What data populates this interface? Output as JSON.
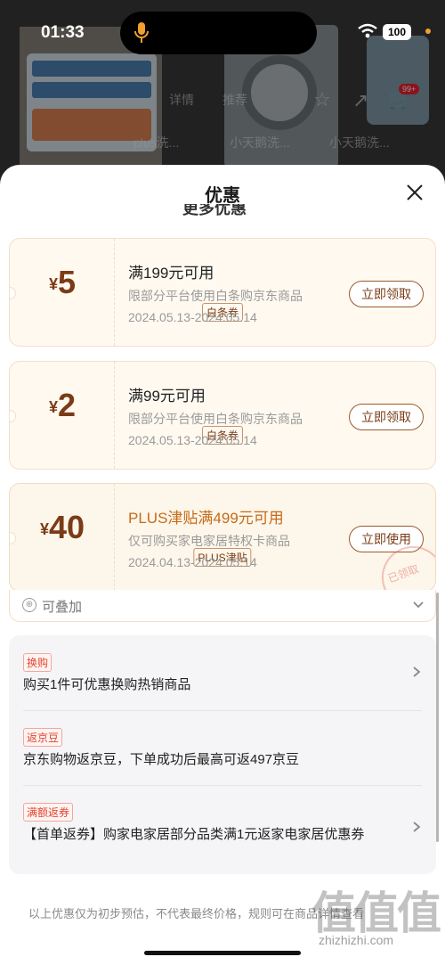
{
  "status_bar": {
    "time": "01:33",
    "battery": "100"
  },
  "background": {
    "detail_label": "详情",
    "recommend_label": "推荐",
    "cart_badge": "99+",
    "thumb_labels": [
      "plus洗...",
      "小天鹅洗...",
      "小天鹅洗..."
    ]
  },
  "sheet": {
    "title": "优惠",
    "peek_heading": "更多优惠",
    "coupons": [
      {
        "currency": "¥",
        "amount": "5",
        "type_tag": "白条券",
        "title": "满199元可用",
        "desc": "限部分平台使用白条购京东商品",
        "date_range": "2024.05.13-2024.05.14",
        "button": "立即领取"
      },
      {
        "currency": "¥",
        "amount": "2",
        "type_tag": "白条券",
        "title": "满99元可用",
        "desc": "限部分平台使用白条购京东商品",
        "date_range": "2024.05.13-2024.05.14",
        "button": "立即领取"
      },
      {
        "currency": "¥",
        "amount": "40",
        "type_tag": "PLUS津贴",
        "title": "PLUS津贴满499元可用",
        "desc": "仅可购买家电家居特权卡商品",
        "date_range": "2024.04.13-2024.05.14",
        "button": "立即使用",
        "stamp": "已领取"
      }
    ],
    "stackable_label": "可叠加",
    "promos": [
      {
        "tag": "换购",
        "text": "购买1件可优惠换购热销商品"
      },
      {
        "tag": "返京豆",
        "text": "京东购物返京豆，下单成功后最高可返497京豆"
      },
      {
        "tag": "满额返券",
        "text": "【首单返券】购家电家居部分品类满1元返家电家居优惠券"
      }
    ],
    "footer_note": "以上优惠仅为初步预估，不代表最终价格，规则可在商品详情查看"
  },
  "watermark": {
    "logo": "值值值",
    "url": "zhizhizhi.com"
  },
  "colors": {
    "accent_brown": "#7a3b16",
    "plus_orange": "#c56b1a",
    "promo_red": "#e2452f"
  }
}
